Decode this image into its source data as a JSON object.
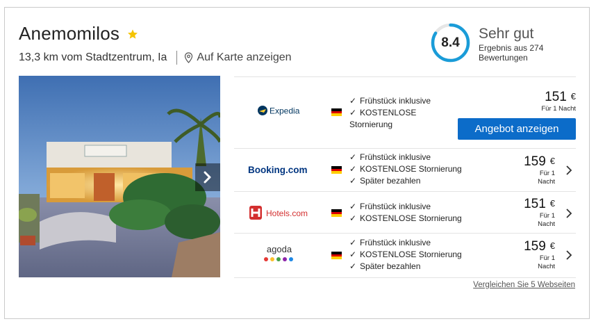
{
  "hotel": {
    "name": "Anemomilos",
    "star_color": "#f5c400",
    "distance": "13,3 km vom Stadtzentrum, Ia",
    "map_link": "Auf Karte anzeigen"
  },
  "rating": {
    "score": "8.4",
    "label": "Sehr gut",
    "count_text": "Ergebnis aus 274 Bewertungen",
    "ring_color": "#1a9cd8"
  },
  "gallery": {
    "next_icon": "chevron-right-icon"
  },
  "offers": [
    {
      "provider": "Expedia",
      "features": [
        "Frühstück inklusive",
        "KOSTENLOSE",
        "Stornierung"
      ],
      "price": "151",
      "currency": "€",
      "per_night": "Für 1 Nacht",
      "button": "Angebot anzeigen"
    },
    {
      "provider": "Booking.com",
      "features": [
        "Frühstück inklusive",
        "KOSTENLOSE Stornierung",
        "Später bezahlen"
      ],
      "price": "159",
      "currency": "€",
      "per_night_1": "Für 1",
      "per_night_2": "Nacht"
    },
    {
      "provider": "Hotels.com",
      "features": [
        "Frühstück inklusive",
        "KOSTENLOSE Stornierung"
      ],
      "price": "151",
      "currency": "€",
      "per_night_1": "Für 1",
      "per_night_2": "Nacht"
    },
    {
      "provider": "agoda",
      "features": [
        "Frühstück inklusive",
        "KOSTENLOSE Stornierung",
        "Später bezahlen"
      ],
      "price": "159",
      "currency": "€",
      "per_night_1": "Für 1",
      "per_night_2": "Nacht"
    }
  ],
  "compare_link": "Vergleichen Sie 5 Webseiten",
  "colors": {
    "accent_button": "#0c6cc9",
    "booking_blue": "#003580",
    "hotels_red": "#d32f2f",
    "expedia_navy": "#00355f",
    "expedia_yellow": "#fbcc33"
  }
}
